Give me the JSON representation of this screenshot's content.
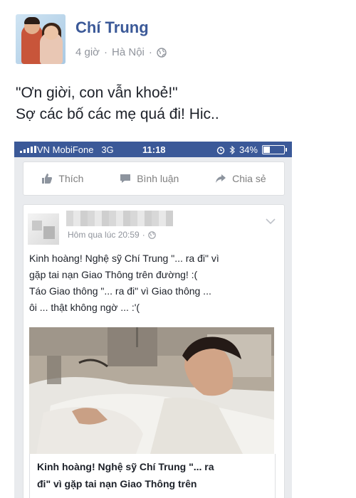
{
  "post": {
    "author": "Chí Trung",
    "time": "4 giờ",
    "separator": "·",
    "location": "Hà Nội",
    "dot": "·",
    "privacy_icon": "globe-icon",
    "text_line_1": "\"Ơn giời, con vẫn khoẻ!\"",
    "text_line_2": "Sợ các bố các mẹ quá đi! Hic.."
  },
  "screenshot": {
    "status_bar": {
      "carrier": "VN MobiFone",
      "network": "3G",
      "time": "11:18",
      "battery": "34%",
      "color": "#3b5998"
    },
    "actions": {
      "like": "Thích",
      "comment": "Bình luận",
      "share": "Chia sẻ"
    },
    "inner_post": {
      "meta_time": "Hôm qua lúc 20:59",
      "meta_dot": "·",
      "text_line_1": "Kinh hoàng! Nghệ sỹ Chí Trung \"... ra đi\" vì",
      "text_line_2": "gặp tai nạn Giao Thông trên đường! :(",
      "text_line_3": "Táo Giao thông \"... ra đi\" vì Giao thông ...",
      "text_line_4": "ôi ... thật không ngờ ... :'(",
      "link_title_line_1": "Kinh hoàng! Nghệ sỹ Chí Trung \"... ra",
      "link_title_line_2": "đi\" vì gặp tai nạn Giao Thông trên"
    }
  },
  "colors": {
    "facebook_blue": "#3b5998",
    "meta_gray": "#90949c"
  }
}
